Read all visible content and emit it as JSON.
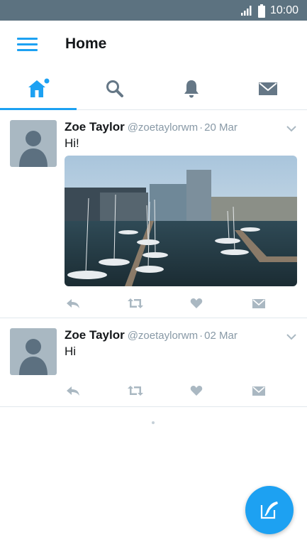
{
  "status_bar": {
    "time": "10:00"
  },
  "header": {
    "title": "Home"
  },
  "tabs": [
    {
      "name": "home",
      "icon": "home-icon",
      "active": true
    },
    {
      "name": "search",
      "icon": "search-icon",
      "active": false
    },
    {
      "name": "notifications",
      "icon": "bell-icon",
      "active": false
    },
    {
      "name": "messages",
      "icon": "mail-icon",
      "active": false
    }
  ],
  "tweets": [
    {
      "name": "Zoe Taylor",
      "handle": "@zoetaylorwm",
      "separator": "·",
      "date": "20 Mar",
      "text": "Hi!",
      "has_media": true
    },
    {
      "name": "Zoe Taylor",
      "handle": "@zoetaylorwm",
      "separator": "·",
      "date": "02 Mar",
      "text": "Hi",
      "has_media": false
    }
  ],
  "colors": {
    "accent": "#1da1f2",
    "status_bar": "#5c7280",
    "muted": "#8899a6",
    "icon_muted": "#aab8c2",
    "divider": "#e1e8ed"
  }
}
